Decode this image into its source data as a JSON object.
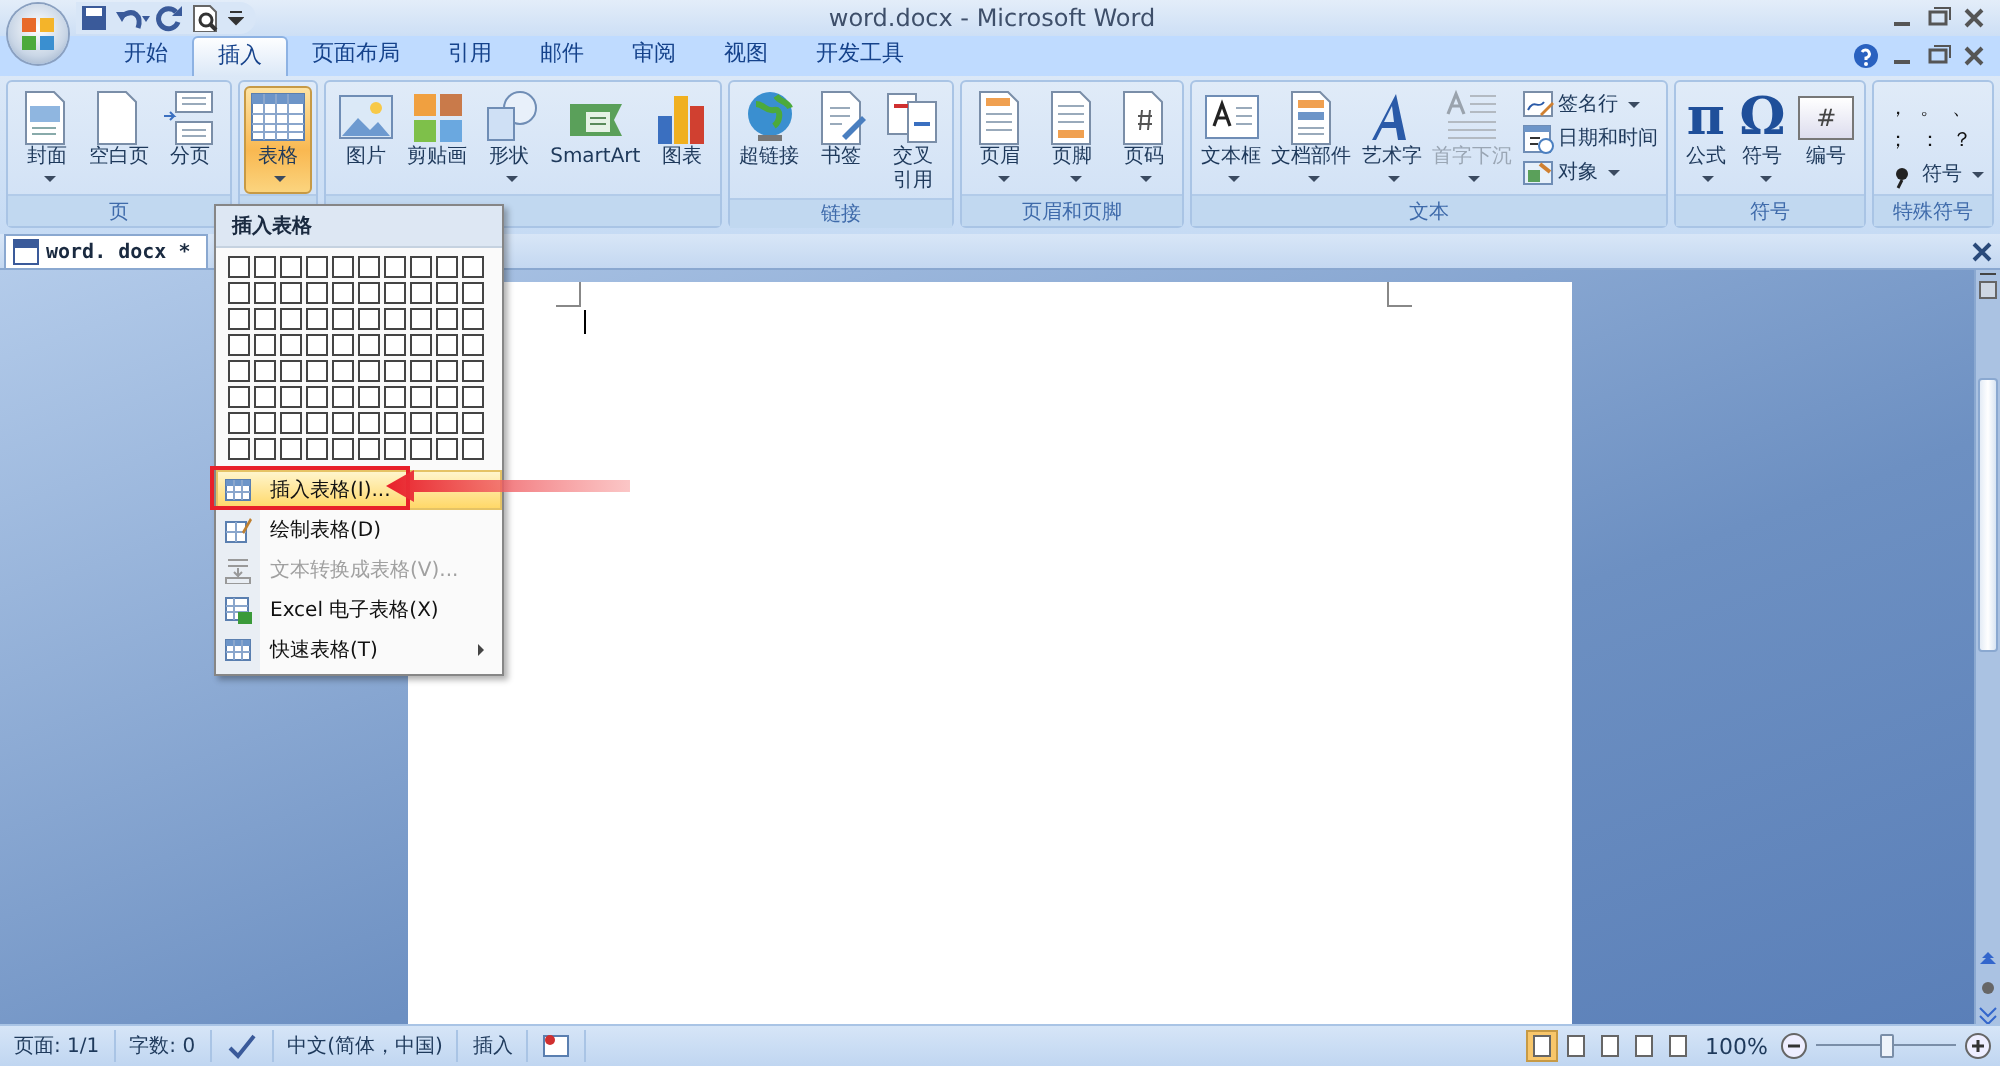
{
  "window": {
    "title": "word.docx - Microsoft Word"
  },
  "tabs": [
    {
      "label": "开始",
      "selected": false
    },
    {
      "label": "插入",
      "selected": true
    },
    {
      "label": "页面布局",
      "selected": false
    },
    {
      "label": "引用",
      "selected": false
    },
    {
      "label": "邮件",
      "selected": false
    },
    {
      "label": "审阅",
      "selected": false
    },
    {
      "label": "视图",
      "selected": false
    },
    {
      "label": "开发工具",
      "selected": false
    }
  ],
  "ribbon": {
    "groups": [
      {
        "label": "页",
        "buttons": [
          {
            "label": "封面",
            "dropdown": true,
            "pressed": false,
            "disabled": false
          },
          {
            "label": "空白页",
            "dropdown": false,
            "pressed": false,
            "disabled": false
          },
          {
            "label": "分页",
            "dropdown": false,
            "pressed": false,
            "disabled": false
          }
        ]
      },
      {
        "buttons": [
          {
            "label": "表格",
            "dropdown": true,
            "pressed": true,
            "disabled": false
          }
        ]
      },
      {
        "buttons": [
          {
            "label": "图片",
            "dropdown": false,
            "pressed": false,
            "disabled": false
          },
          {
            "label": "剪贴画",
            "dropdown": false,
            "pressed": false,
            "disabled": false
          },
          {
            "label": "形状",
            "dropdown": true,
            "pressed": false,
            "disabled": false
          },
          {
            "label": "SmartArt",
            "dropdown": false,
            "pressed": false,
            "disabled": false
          },
          {
            "label": "图表",
            "dropdown": false,
            "pressed": false,
            "disabled": false
          }
        ]
      },
      {
        "label": "链接",
        "buttons": [
          {
            "label": "超链接",
            "dropdown": false,
            "pressed": false,
            "disabled": false
          },
          {
            "label": "书签",
            "dropdown": false,
            "pressed": false,
            "disabled": false
          },
          {
            "label": "交叉引用",
            "dropdown": false,
            "pressed": false,
            "disabled": false
          }
        ]
      },
      {
        "label": "页眉和页脚",
        "buttons": [
          {
            "label": "页眉",
            "dropdown": true,
            "pressed": false,
            "disabled": false
          },
          {
            "label": "页脚",
            "dropdown": true,
            "pressed": false,
            "disabled": false
          },
          {
            "label": "页码",
            "dropdown": true,
            "pressed": false,
            "disabled": false
          }
        ]
      },
      {
        "label": "文本",
        "buttons": [
          {
            "label": "文本框",
            "dropdown": true,
            "pressed": false,
            "disabled": false
          },
          {
            "label": "文档部件",
            "dropdown": true,
            "pressed": false,
            "disabled": false
          },
          {
            "label": "艺术字",
            "dropdown": true,
            "pressed": false,
            "disabled": false
          },
          {
            "label": "首字下沉",
            "dropdown": true,
            "pressed": false,
            "disabled": true
          }
        ],
        "small_buttons": [
          {
            "label": "签名行",
            "dropdown": true
          },
          {
            "label": "日期和时间",
            "dropdown": false
          },
          {
            "label": "对象",
            "dropdown": true
          }
        ]
      },
      {
        "label": "符号",
        "buttons": [
          {
            "label": "公式",
            "glyph": "π",
            "dropdown": true,
            "pressed": false,
            "disabled": false
          },
          {
            "label": "符号",
            "glyph": "Ω",
            "dropdown": true,
            "pressed": false,
            "disabled": false
          },
          {
            "label": "编号",
            "glyph": "#",
            "dropdown": false,
            "pressed": false,
            "disabled": false
          }
        ]
      },
      {
        "label": "特殊符号",
        "symbols": [
          "，",
          "。",
          "、",
          "；",
          "：",
          "？"
        ],
        "small_buttons": [
          {
            "label": "符号",
            "dropdown": true
          }
        ]
      }
    ]
  },
  "document_tab": {
    "label": "word. docx *"
  },
  "table_menu": {
    "title": "插入表格",
    "items": [
      {
        "label": "插入表格(I)...",
        "selected": true,
        "disabled": false,
        "submenu": false
      },
      {
        "label": "绘制表格(D)",
        "selected": false,
        "disabled": false,
        "submenu": false
      },
      {
        "label": "文本转换成表格(V)...",
        "selected": false,
        "disabled": true,
        "submenu": false
      },
      {
        "label": "Excel 电子表格(X)",
        "selected": false,
        "disabled": false,
        "submenu": false
      },
      {
        "label": "快速表格(T)",
        "selected": false,
        "disabled": false,
        "submenu": true
      }
    ]
  },
  "status_bar": {
    "items": [
      "页面: 1/1",
      "字数: 0",
      "中文(简体，中国)",
      "插入"
    ],
    "views": [
      {
        "selected": true
      },
      {
        "selected": false
      },
      {
        "selected": false
      },
      {
        "selected": false
      },
      {
        "selected": false
      }
    ],
    "zoom": {
      "reading": "100%",
      "level": 0.5
    }
  }
}
